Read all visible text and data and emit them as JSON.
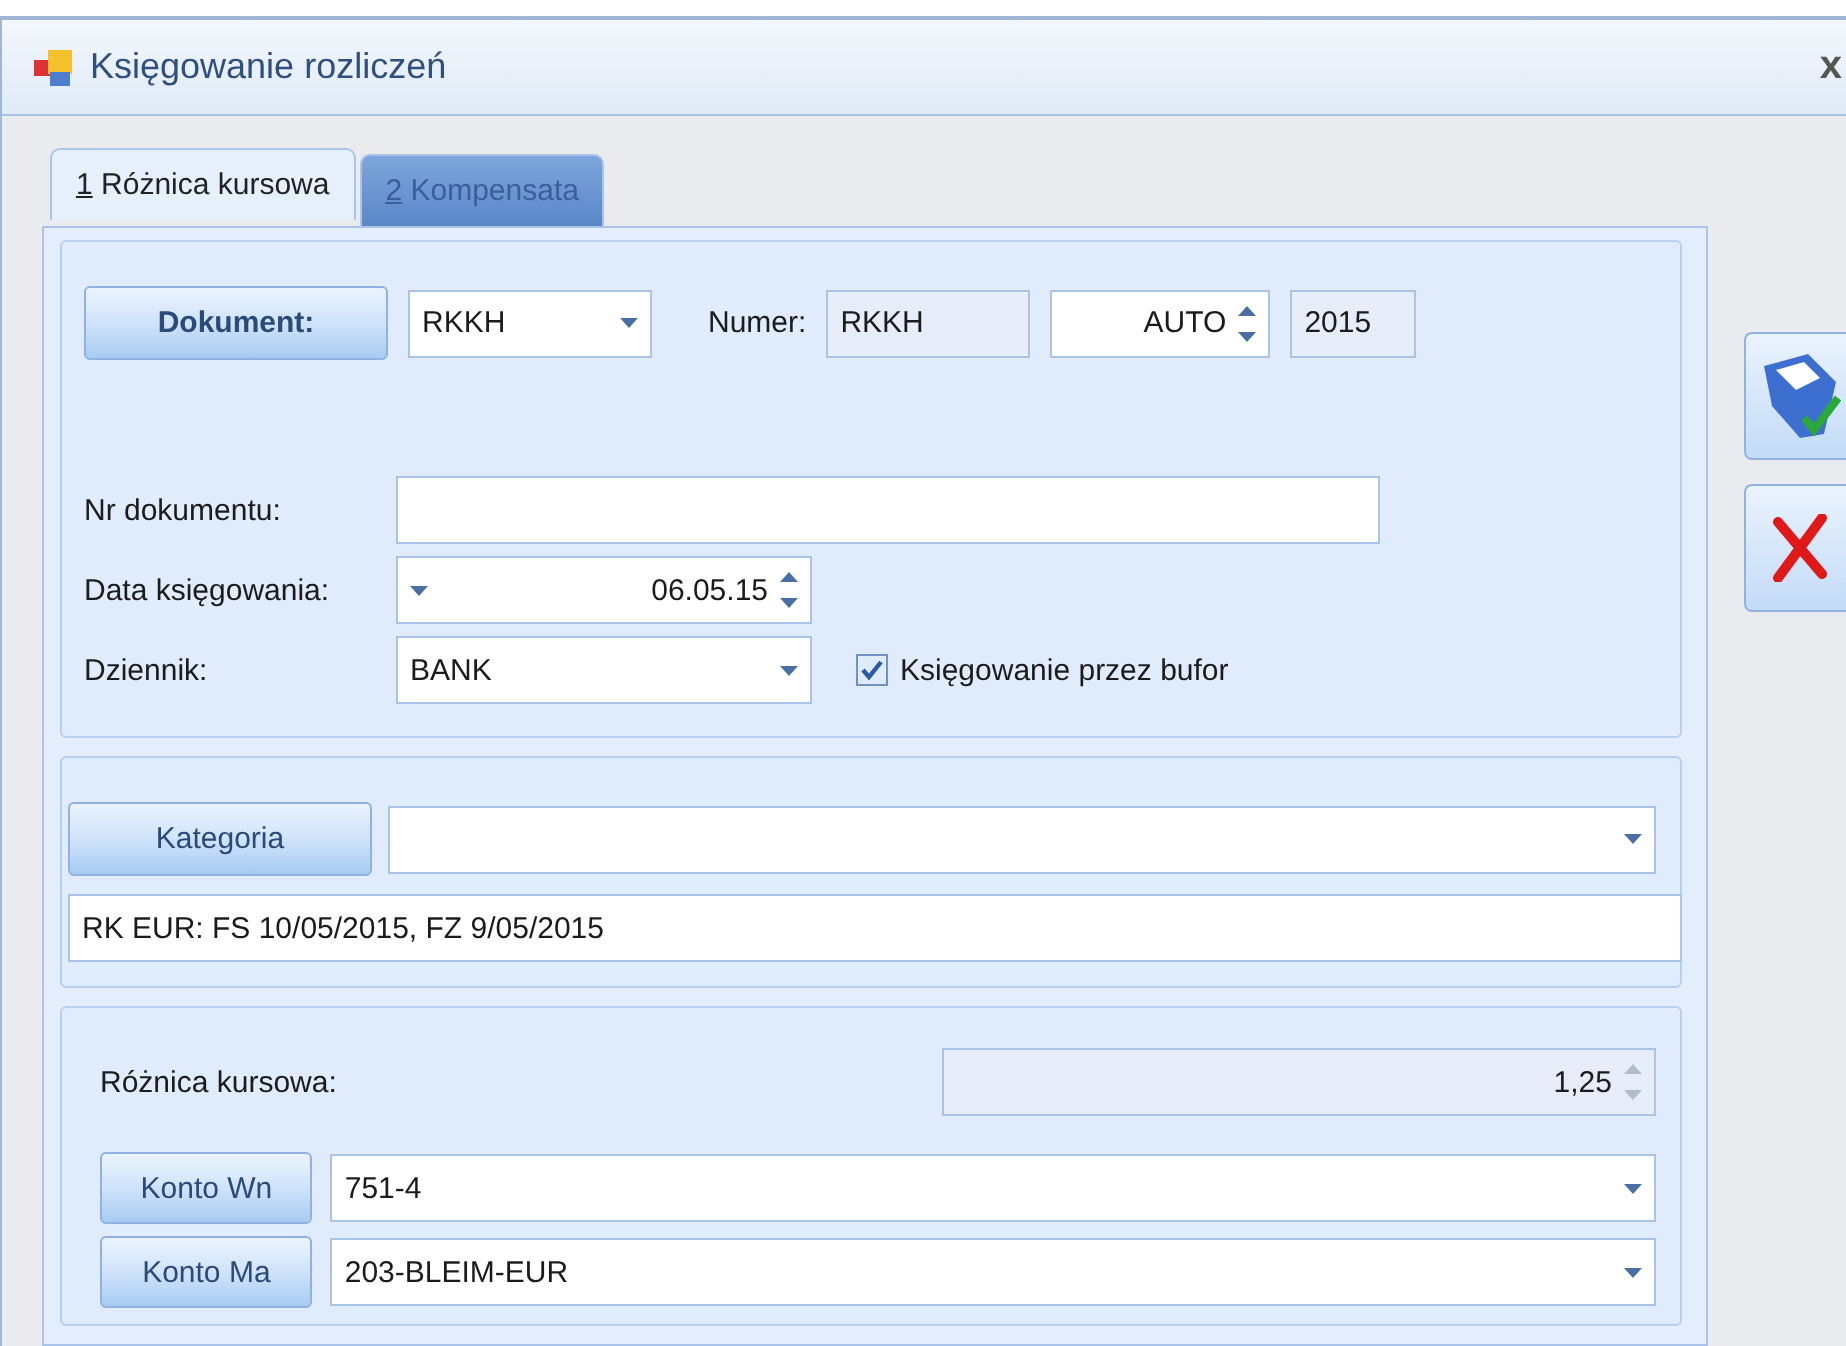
{
  "window": {
    "title": "Księgowanie rozliczeń",
    "close": "x"
  },
  "tabs": [
    {
      "key": "1",
      "label": "Różnica kursowa",
      "selected": true
    },
    {
      "key": "2",
      "label": "Kompensata",
      "selected": false
    }
  ],
  "document": {
    "button": "Dokument:",
    "type": "RKKH",
    "number_label": "Numer:",
    "number_prefix": "RKKH",
    "number": "AUTO",
    "year": "2015"
  },
  "fields": {
    "doc_number_label": "Nr dokumentu:",
    "date_label": "Data księgowania:",
    "date": "06.05.15",
    "journal_label": "Dziennik:",
    "journal": "BANK",
    "buffer_label": "Księgowanie przez bufor",
    "buffer_checked": true
  },
  "category": {
    "button": "Kategoria",
    "description": "RK EUR: FS 10/05/2015, FZ 9/05/2015"
  },
  "difference": {
    "label": "Różnica kursowa:",
    "value": "1,25"
  },
  "accounts": [
    {
      "button": "Konto Wn",
      "value": "751-4"
    },
    {
      "button": "Konto Ma",
      "value": "203-BLEIM-EUR"
    }
  ]
}
